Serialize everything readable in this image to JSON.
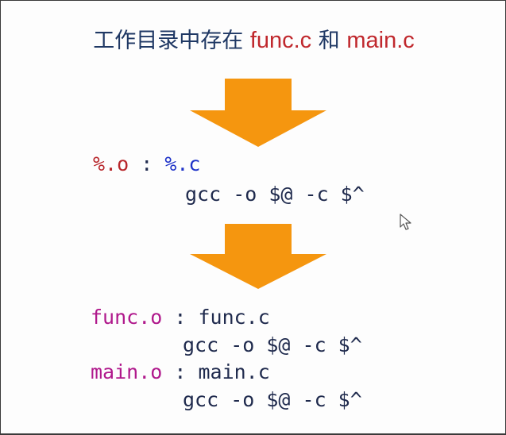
{
  "title": {
    "prefix": "工作目录中存在 ",
    "file1": "func.c",
    "conj": " 和 ",
    "file2": "main.c"
  },
  "pattern_rule": {
    "target": "%.o",
    "sep": " : ",
    "prereq": "%.c",
    "command": "gcc -o $@ -c $^"
  },
  "expanded_rules": [
    {
      "target": "func.o",
      "sep": " : ",
      "prereq": "func.c",
      "command": "gcc -o $@ -c $^"
    },
    {
      "target": "main.o",
      "sep": " : ",
      "prereq": "main.c",
      "command": "gcc -o $@ -c $^"
    }
  ],
  "colors": {
    "title_text": "#1f3864",
    "filename_red": "#c0282d",
    "arrow_orange": "#f5960f",
    "target_magenta": "#b0198c",
    "prereq_blue": "#1e32c8"
  },
  "icons": [
    "down-arrow-icon",
    "mouse-cursor-icon"
  ]
}
